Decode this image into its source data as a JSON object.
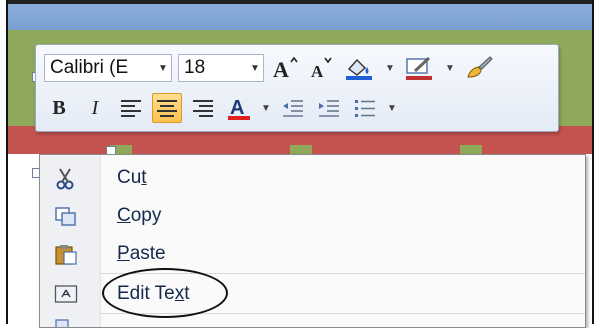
{
  "mini_toolbar": {
    "font_name": "Calibri (E",
    "font_size": "18",
    "row1_buttons": [
      {
        "name": "grow-font-icon",
        "glyph": "A"
      },
      {
        "name": "shrink-font-icon",
        "glyph": "A"
      },
      {
        "name": "fill-color-icon",
        "glyph": "⟰"
      },
      {
        "name": "line-color-icon",
        "glyph": "✎"
      },
      {
        "name": "format-painter-icon",
        "glyph": "🖌"
      }
    ],
    "row2_buttons": [
      {
        "name": "bold-button",
        "glyph": "B"
      },
      {
        "name": "italic-button",
        "glyph": "I"
      },
      {
        "name": "align-left-icon",
        "glyph": "≡"
      },
      {
        "name": "align-center-icon",
        "glyph": "≡",
        "active": true
      },
      {
        "name": "align-right-icon",
        "glyph": "≡"
      },
      {
        "name": "font-color-icon",
        "glyph": "A"
      },
      {
        "name": "decrease-indent-icon",
        "glyph": "⇤"
      },
      {
        "name": "increase-indent-icon",
        "glyph": "⇥"
      },
      {
        "name": "bullets-icon",
        "glyph": "☰"
      }
    ],
    "font_color": "#e02020",
    "fill_color": "#1e5fd6",
    "line_color": "#c03030"
  },
  "context_menu": {
    "items": [
      {
        "label_pre": "Cu",
        "label_u": "t",
        "label_post": "",
        "icon": "scissors-icon"
      },
      {
        "label_pre": "",
        "label_u": "C",
        "label_post": "opy",
        "icon": "copy-icon"
      },
      {
        "label_pre": "",
        "label_u": "P",
        "label_post": "aste",
        "icon": "paste-icon"
      },
      {
        "label_pre": "Edit Te",
        "label_u": "x",
        "label_post": "t",
        "icon": "edit-text-icon"
      }
    ]
  },
  "colors": {
    "slide_blue": "#7aa0d2",
    "slide_green": "#8fa95b",
    "slide_red": "#c4524f",
    "highlight": "#ffc14f"
  }
}
